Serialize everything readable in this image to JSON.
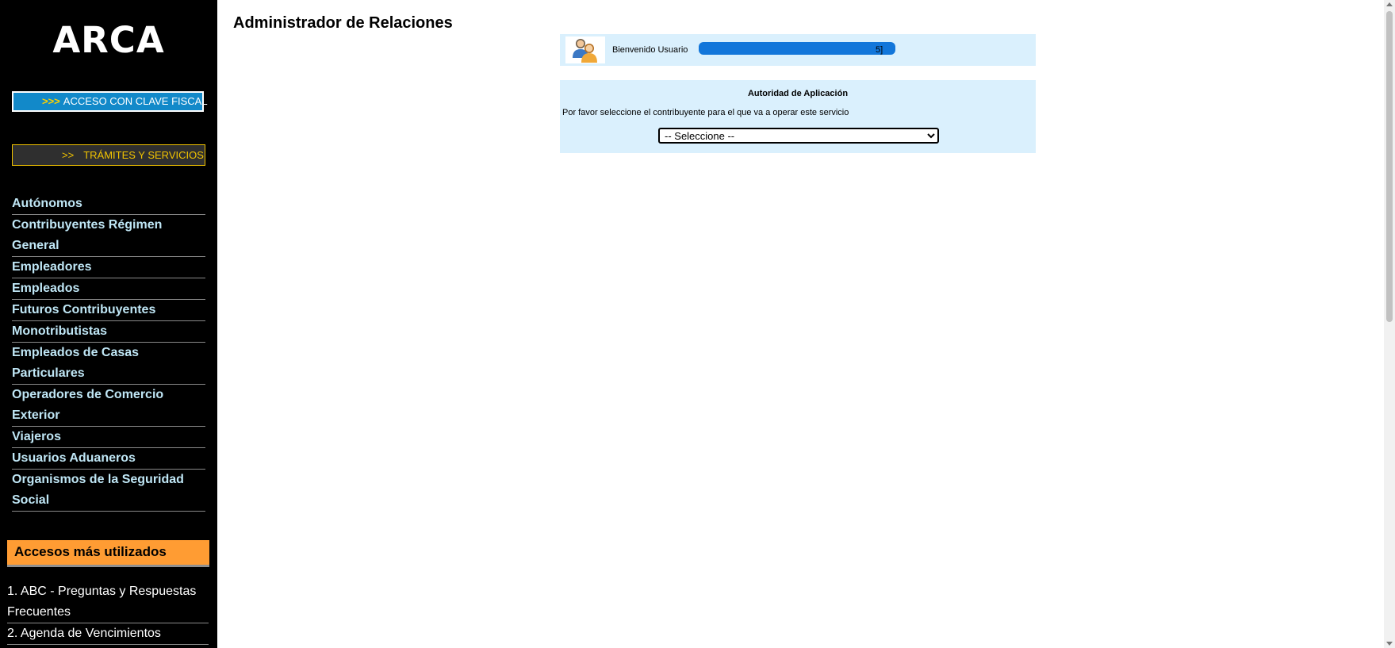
{
  "sidebar": {
    "logo": "ARCA",
    "clave_button": {
      "arrows": ">>>",
      "label": "ACCESO CON CLAVE FISCAL"
    },
    "tramites_button": {
      "arrows": ">>",
      "label": "TRÁMITES Y SERVICIOS"
    },
    "nav_items": [
      "Autónomos",
      "Contribuyentes Régimen General",
      "Empleadores",
      "Empleados",
      "Futuros Contribuyentes",
      "Monotributistas",
      "Empleados de Casas Particulares",
      "Operadores de Comercio Exterior",
      "Viajeros",
      "Usuarios Aduaneros",
      "Organismos de la Seguridad Social"
    ],
    "accesos_header": "Accesos más utilizados",
    "accesos_items": [
      "1. ABC - Preguntas y Respuestas Frecuentes",
      "2. Agenda de Vencimientos"
    ]
  },
  "main": {
    "title": "Administrador de Relaciones",
    "welcome": {
      "text": "Bienvenido Usuario",
      "suffix": "5]"
    },
    "authority": {
      "title": "Autoridad de Aplicación",
      "instruction": "Por favor seleccione el contribuyente para el que va a operar este servicio",
      "select_value": "-- Seleccione --"
    }
  },
  "colors": {
    "sidebar_bg": "#000000",
    "clave_button_bg": "#1289c9",
    "tramites_border": "#f2c400",
    "nav_link": "#bfe6f5",
    "accesos_header_bg": "#ff9c33",
    "info_box_bg": "#daf0fd"
  },
  "icons": {
    "avatar": "users-icon"
  }
}
